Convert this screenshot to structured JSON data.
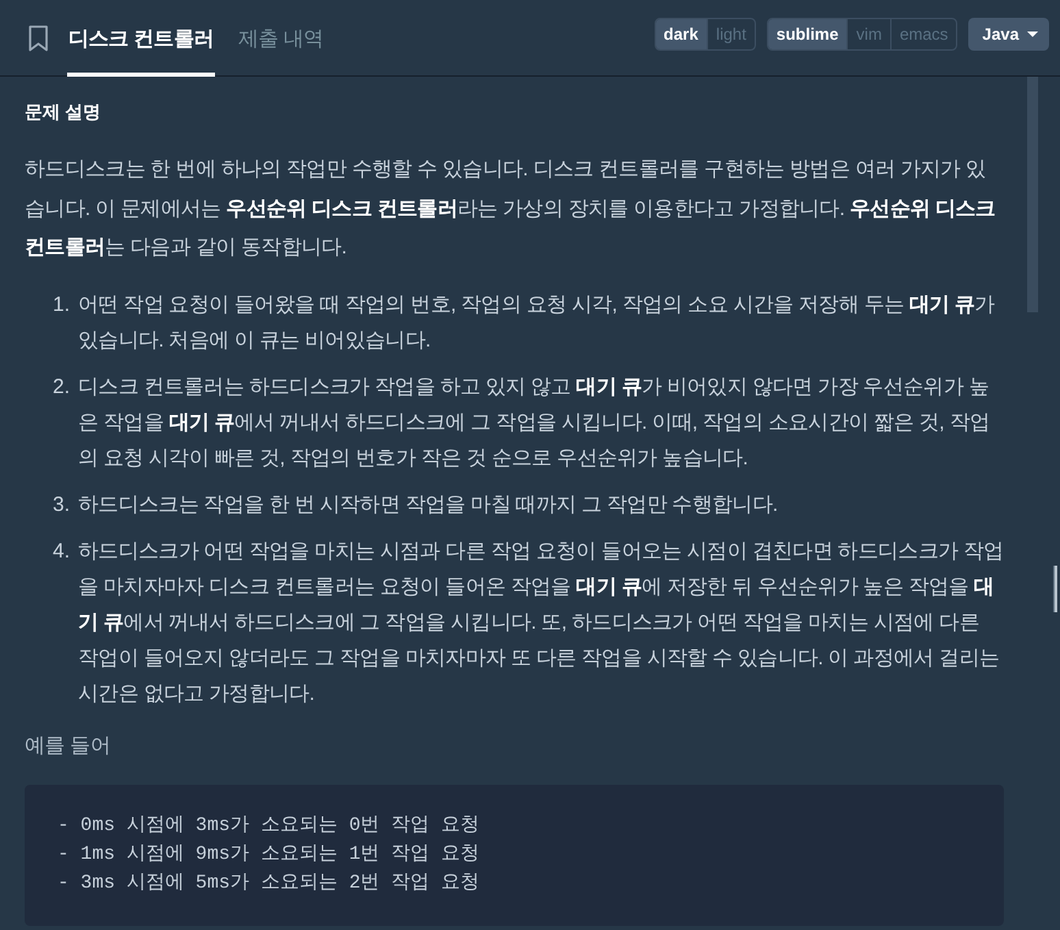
{
  "header": {
    "tabs": [
      {
        "label": "디스크 컨트롤러",
        "selected": true
      },
      {
        "label": "제출 내역",
        "selected": false
      }
    ],
    "theme_toggle": [
      {
        "label": "dark",
        "selected": true
      },
      {
        "label": "light",
        "selected": false
      }
    ],
    "keymap_toggle": [
      {
        "label": "sublime",
        "selected": true
      },
      {
        "label": "vim",
        "selected": false
      },
      {
        "label": "emacs",
        "selected": false
      }
    ],
    "language": {
      "label": "Java"
    }
  },
  "description": {
    "heading": "문제 설명",
    "paragraphs": [
      "하드디스크는 한 번에 하나의 작업만 수행할 수 있습니다. 디스크 컨트롤러를 구현하는 방법은 여러 가지가 있습니다. 이 문제에서는 **우선순위 디스크 컨트롤러**라는 가상의 장치를 이용한다고 가정합니다. **우선순위 디스크 컨트롤러**는 다음과 같이 동작합니다."
    ],
    "list": [
      {
        "number": "1.",
        "text": "어떤 작업 요청이 들어왔을 때 작업의 번호, 작업의 요청 시각, 작업의 소요 시간을 저장해 두는 **대기 큐**가 있습니다. 처음에 이 큐는 비어있습니다."
      },
      {
        "number": "2.",
        "text": "디스크 컨트롤러는 하드디스크가 작업을 하고 있지 않고 **대기 큐**가 비어있지 않다면 가장 우선순위가 높은 작업을 **대기 큐**에서 꺼내서 하드디스크에 그 작업을 시킵니다. 이때, 작업의 소요시간이 짧은 것, 작업의 요청 시각이 빠른 것, 작업의 번호가 작은 것 순으로 우선순위가 높습니다."
      },
      {
        "number": "3.",
        "text": "하드디스크는 작업을 한 번 시작하면 작업을 마칠 때까지 그 작업만 수행합니다."
      },
      {
        "number": "4.",
        "text": "하드디스크가 어떤 작업을 마치는 시점과 다른 작업 요청이 들어오는 시점이 겹친다면 하드디스크가 작업을 마치자마자 디스크 컨트롤러는 요청이 들어온 작업을 **대기 큐**에 저장한 뒤 우선순위가 높은 작업을 **대기 큐**에서 꺼내서 하드디스크에 그 작업을 시킵니다. 또, 하드디스크가 어떤 작업을 마치는 시점에 다른 작업이 들어오지 않더라도 그 작업을 마치자마자 또 다른 작업을 시작할 수 있습니다. 이 과정에서 걸리는 시간은 없다고 가정합니다."
      }
    ],
    "example_intro": "예를 들어",
    "code_lines": [
      "- 0ms 시점에 3ms가 소요되는 0번 작업 요청",
      "- 1ms 시점에 9ms가 소요되는 1번 작업 요청",
      "- 3ms 시점에 5ms가 소요되는 2번 작업 요청"
    ]
  }
}
